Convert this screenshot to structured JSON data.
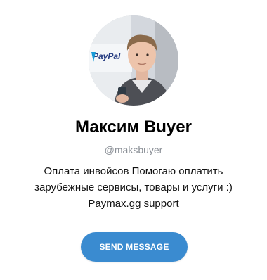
{
  "profile": {
    "avatar_description_icon": "profile-photo",
    "avatar_logo_text": "PayPal",
    "name": "Максим Buyer",
    "username": "@maksbuyer",
    "bio_lines": [
      "Оплата инвойсов Помогаю оплатить",
      "зарубежные сервисы, товары и услуги :)",
      "Paymax.gg support"
    ]
  },
  "actions": {
    "send_message_label": "SEND MESSAGE"
  },
  "colors": {
    "button_bg": "#3a8bd0",
    "username": "#8a8f96",
    "paypal_dark": "#253b80",
    "paypal_light": "#179bd7"
  }
}
